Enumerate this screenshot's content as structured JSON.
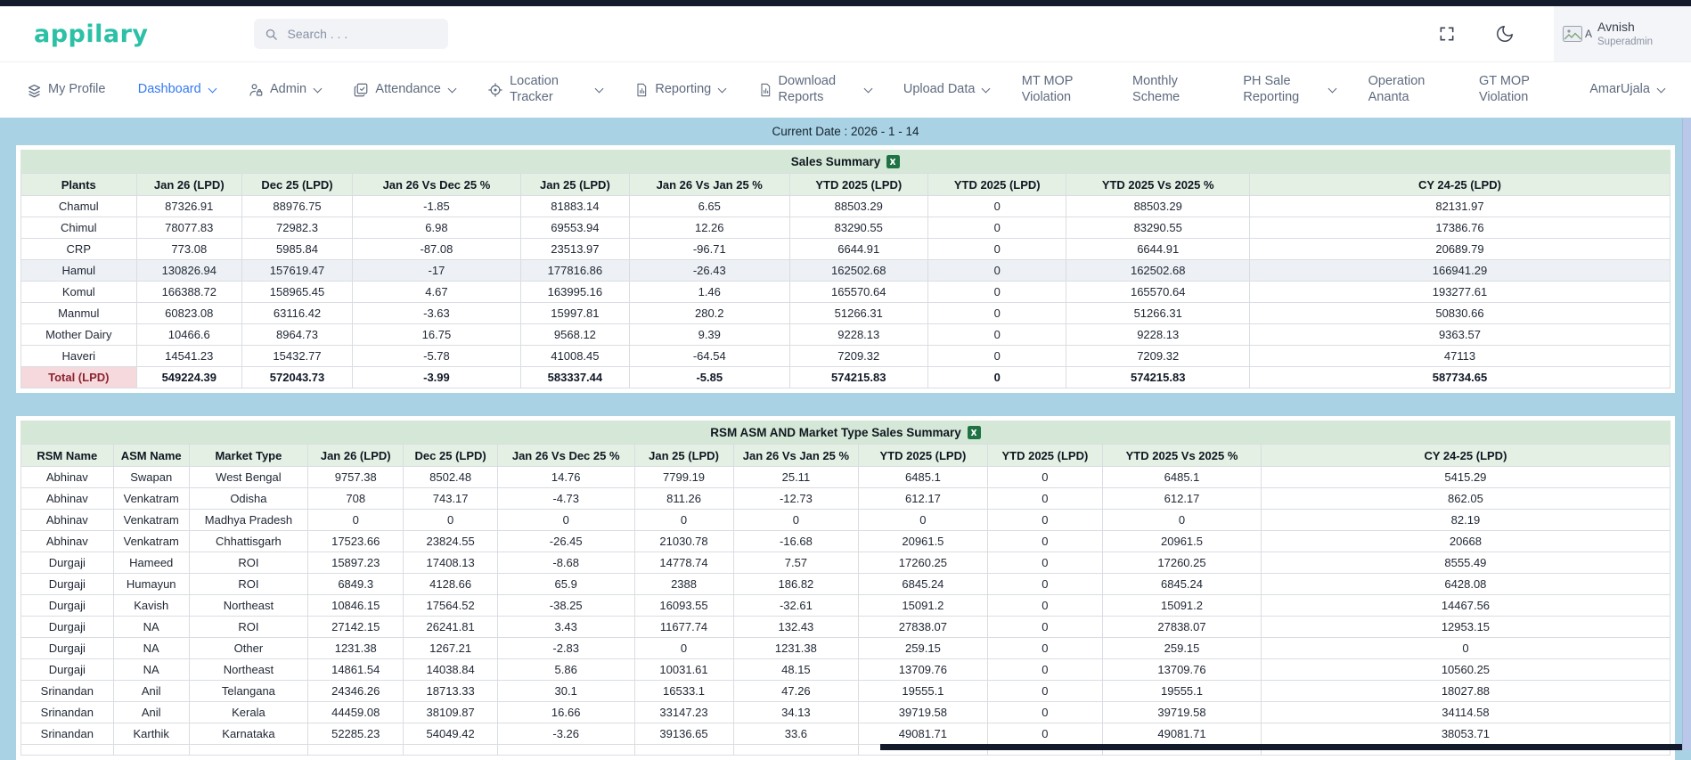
{
  "topbar": {
    "logo": "appilary",
    "search_placeholder": "Search . . .",
    "avatar_alt": "A",
    "user_name": "Avnish",
    "user_role": "Superadmin"
  },
  "nav": {
    "items": [
      {
        "label": "My Profile",
        "icon": "layers-icon",
        "chevron": false,
        "active": false
      },
      {
        "label": "Dashboard",
        "icon": null,
        "chevron": true,
        "active": true
      },
      {
        "label": "Admin",
        "icon": "user-lock-icon",
        "chevron": true,
        "active": false
      },
      {
        "label": "Attendance",
        "icon": "checkbox-icon",
        "chevron": true,
        "active": false
      },
      {
        "label": "Location Tracker",
        "icon": "crosshair-icon",
        "chevron": true,
        "active": false
      },
      {
        "label": "Reporting",
        "icon": "file-chart-icon",
        "chevron": true,
        "active": false
      },
      {
        "label": "Download Reports",
        "icon": "file-chart-icon",
        "chevron": true,
        "active": false
      },
      {
        "label": "Upload Data",
        "icon": null,
        "chevron": true,
        "active": false
      },
      {
        "label": "MT MOP Violation",
        "icon": null,
        "chevron": false,
        "active": false
      },
      {
        "label": "Monthly Scheme",
        "icon": null,
        "chevron": false,
        "active": false
      },
      {
        "label": "PH Sale Reporting",
        "icon": null,
        "chevron": true,
        "active": false
      },
      {
        "label": "Operation Ananta",
        "icon": null,
        "chevron": false,
        "active": false
      },
      {
        "label": "GT MOP Violation",
        "icon": null,
        "chevron": false,
        "active": false
      },
      {
        "label": "AmarUjala",
        "icon": null,
        "chevron": true,
        "active": false
      }
    ]
  },
  "current_date_label": "Current Date : 2026 - 1 - 14",
  "colors": {
    "brand_teal": "#2cc0a6",
    "active_nav_blue": "#3478f2",
    "page_background_blue": "#a9d2e4",
    "table_title_green": "#d5e8d7",
    "table_header_green": "#e3f0e3",
    "total_label_pink": "#f5d9dd",
    "total_label_text": "#8c2430",
    "excel_icon_green": "#1f7244",
    "top_strip_dark": "#131a2c"
  },
  "sales_summary": {
    "title": "Sales Summary",
    "excel_icon": "excel-icon",
    "columns": [
      "Plants",
      "Jan 26 (LPD)",
      "Dec 25 (LPD)",
      "Jan 26 Vs Dec 25 %",
      "Jan 25 (LPD)",
      "Jan 26 Vs Jan 25 %",
      "YTD 2025 (LPD)",
      "YTD 2025 (LPD)",
      "YTD 2025 Vs 2025 %",
      "CY 24-25 (LPD)"
    ],
    "rows": [
      [
        "Chamul",
        "87326.91",
        "88976.75",
        "-1.85",
        "81883.14",
        "6.65",
        "88503.29",
        "0",
        "88503.29",
        "82131.97"
      ],
      [
        "Chimul",
        "78077.83",
        "72982.3",
        "6.98",
        "69553.94",
        "12.26",
        "83290.55",
        "0",
        "83290.55",
        "17386.76"
      ],
      [
        "CRP",
        "773.08",
        "5985.84",
        "-87.08",
        "23513.97",
        "-96.71",
        "6644.91",
        "0",
        "6644.91",
        "20689.79"
      ],
      [
        "Hamul",
        "130826.94",
        "157619.47",
        "-17",
        "177816.86",
        "-26.43",
        "162502.68",
        "0",
        "162502.68",
        "166941.29"
      ],
      [
        "Komul",
        "166388.72",
        "158965.45",
        "4.67",
        "163995.16",
        "1.46",
        "165570.64",
        "0",
        "165570.64",
        "193277.61"
      ],
      [
        "Manmul",
        "60823.08",
        "63116.42",
        "-3.63",
        "15997.81",
        "280.2",
        "51266.31",
        "0",
        "51266.31",
        "50830.66"
      ],
      [
        "Mother Dairy",
        "10466.6",
        "8964.73",
        "16.75",
        "9568.12",
        "9.39",
        "9228.13",
        "0",
        "9228.13",
        "9363.57"
      ],
      [
        "Haveri",
        "14541.23",
        "15432.77",
        "-5.78",
        "41008.45",
        "-64.54",
        "7209.32",
        "0",
        "7209.32",
        "47113"
      ]
    ],
    "highlighted_row": "Hamul",
    "total_row": [
      "Total (LPD)",
      "549224.39",
      "572043.73",
      "-3.99",
      "583337.44",
      "-5.85",
      "574215.83",
      "0",
      "574215.83",
      "587734.65"
    ]
  },
  "rsm_summary": {
    "title": "RSM ASM AND Market Type Sales Summary",
    "excel_icon": "excel-icon",
    "columns": [
      "RSM Name",
      "ASM Name",
      "Market Type",
      "Jan 26 (LPD)",
      "Dec 25 (LPD)",
      "Jan 26 Vs Dec 25 %",
      "Jan 25 (LPD)",
      "Jan 26 Vs Jan 25 %",
      "YTD 2025 (LPD)",
      "YTD 2025 (LPD)",
      "YTD 2025 Vs 2025 %",
      "CY 24-25 (LPD)"
    ],
    "rows": [
      [
        "Abhinav",
        "Swapan",
        "West Bengal",
        "9757.38",
        "8502.48",
        "14.76",
        "7799.19",
        "25.11",
        "6485.1",
        "0",
        "6485.1",
        "5415.29"
      ],
      [
        "Abhinav",
        "Venkatram",
        "Odisha",
        "708",
        "743.17",
        "-4.73",
        "811.26",
        "-12.73",
        "612.17",
        "0",
        "612.17",
        "862.05"
      ],
      [
        "Abhinav",
        "Venkatram",
        "Madhya Pradesh",
        "0",
        "0",
        "0",
        "0",
        "0",
        "0",
        "0",
        "0",
        "82.19"
      ],
      [
        "Abhinav",
        "Venkatram",
        "Chhattisgarh",
        "17523.66",
        "23824.55",
        "-26.45",
        "21030.78",
        "-16.68",
        "20961.5",
        "0",
        "20961.5",
        "20668"
      ],
      [
        "Durgaji",
        "Hameed",
        "ROI",
        "15897.23",
        "17408.13",
        "-8.68",
        "14778.74",
        "7.57",
        "17260.25",
        "0",
        "17260.25",
        "8555.49"
      ],
      [
        "Durgaji",
        "Humayun",
        "ROI",
        "6849.3",
        "4128.66",
        "65.9",
        "2388",
        "186.82",
        "6845.24",
        "0",
        "6845.24",
        "6428.08"
      ],
      [
        "Durgaji",
        "Kavish",
        "Northeast",
        "10846.15",
        "17564.52",
        "-38.25",
        "16093.55",
        "-32.61",
        "15091.2",
        "0",
        "15091.2",
        "14467.56"
      ],
      [
        "Durgaji",
        "NA",
        "ROI",
        "27142.15",
        "26241.81",
        "3.43",
        "11677.74",
        "132.43",
        "27838.07",
        "0",
        "27838.07",
        "12953.15"
      ],
      [
        "Durgaji",
        "NA",
        "Other",
        "1231.38",
        "1267.21",
        "-2.83",
        "0",
        "1231.38",
        "259.15",
        "0",
        "259.15",
        "0"
      ],
      [
        "Durgaji",
        "NA",
        "Northeast",
        "14861.54",
        "14038.84",
        "5.86",
        "10031.61",
        "48.15",
        "13709.76",
        "0",
        "13709.76",
        "10560.25"
      ],
      [
        "Srinandan",
        "Anil",
        "Telangana",
        "24346.26",
        "18713.33",
        "30.1",
        "16533.1",
        "47.26",
        "19555.1",
        "0",
        "19555.1",
        "18027.88"
      ],
      [
        "Srinandan",
        "Anil",
        "Kerala",
        "44459.08",
        "38109.87",
        "16.66",
        "33147.23",
        "34.13",
        "39719.58",
        "0",
        "39719.58",
        "34114.58"
      ],
      [
        "Srinandan",
        "Karthik",
        "Karnataka",
        "52285.23",
        "54049.42",
        "-3.26",
        "39136.65",
        "33.6",
        "49081.71",
        "0",
        "49081.71",
        "38053.71"
      ]
    ]
  }
}
